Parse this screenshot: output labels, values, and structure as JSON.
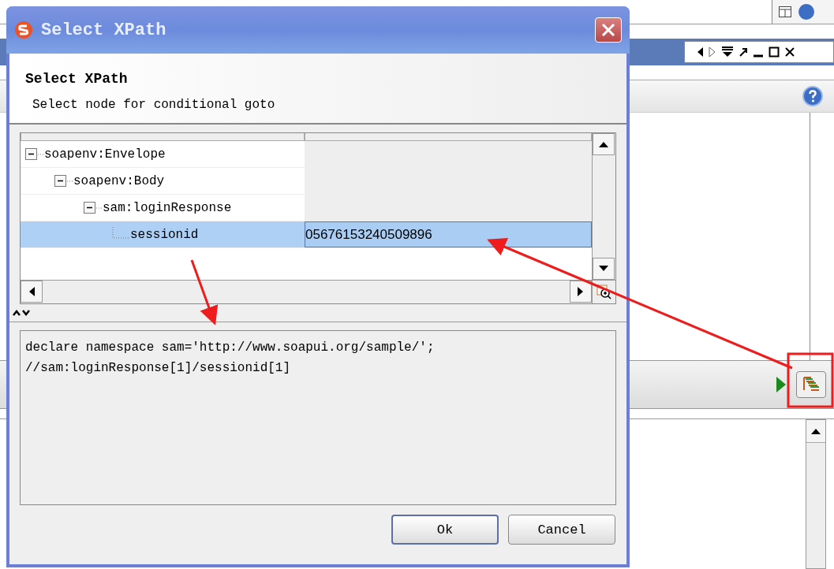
{
  "dialog": {
    "title": "Select XPath",
    "heading": "Select XPath",
    "description": "Select node for conditional goto",
    "tree": [
      {
        "name": "soapenv:Envelope",
        "expanded": true,
        "selected": false,
        "children": [
          {
            "name": "soapenv:Body",
            "expanded": true,
            "selected": false,
            "children": [
              {
                "name": "sam:loginResponse",
                "expanded": true,
                "selected": false,
                "children": [
                  {
                    "name": "sessionid",
                    "value": "05676153240509896",
                    "selected": true
                  }
                ]
              }
            ]
          }
        ]
      }
    ],
    "xpath": "declare namespace sam='http://www.soapui.org/sample/';\n//sam:loginResponse[1]/sessionid[1]",
    "buttons": [
      {
        "label": "Ok",
        "default": true
      },
      {
        "label": "Cancel",
        "default": false
      }
    ]
  }
}
